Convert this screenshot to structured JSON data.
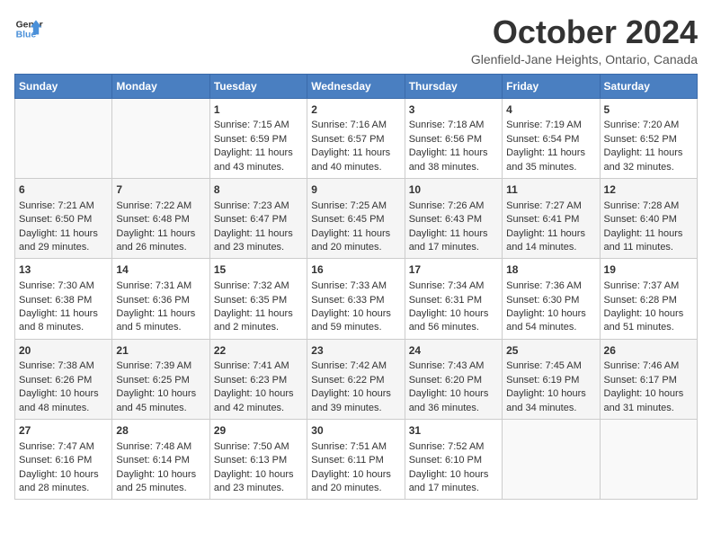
{
  "logo": {
    "line1": "General",
    "line2": "Blue"
  },
  "title": "October 2024",
  "subtitle": "Glenfield-Jane Heights, Ontario, Canada",
  "headers": [
    "Sunday",
    "Monday",
    "Tuesday",
    "Wednesday",
    "Thursday",
    "Friday",
    "Saturday"
  ],
  "weeks": [
    [
      {
        "day": "",
        "sunrise": "",
        "sunset": "",
        "daylight": ""
      },
      {
        "day": "",
        "sunrise": "",
        "sunset": "",
        "daylight": ""
      },
      {
        "day": "1",
        "sunrise": "Sunrise: 7:15 AM",
        "sunset": "Sunset: 6:59 PM",
        "daylight": "Daylight: 11 hours and 43 minutes."
      },
      {
        "day": "2",
        "sunrise": "Sunrise: 7:16 AM",
        "sunset": "Sunset: 6:57 PM",
        "daylight": "Daylight: 11 hours and 40 minutes."
      },
      {
        "day": "3",
        "sunrise": "Sunrise: 7:18 AM",
        "sunset": "Sunset: 6:56 PM",
        "daylight": "Daylight: 11 hours and 38 minutes."
      },
      {
        "day": "4",
        "sunrise": "Sunrise: 7:19 AM",
        "sunset": "Sunset: 6:54 PM",
        "daylight": "Daylight: 11 hours and 35 minutes."
      },
      {
        "day": "5",
        "sunrise": "Sunrise: 7:20 AM",
        "sunset": "Sunset: 6:52 PM",
        "daylight": "Daylight: 11 hours and 32 minutes."
      }
    ],
    [
      {
        "day": "6",
        "sunrise": "Sunrise: 7:21 AM",
        "sunset": "Sunset: 6:50 PM",
        "daylight": "Daylight: 11 hours and 29 minutes."
      },
      {
        "day": "7",
        "sunrise": "Sunrise: 7:22 AM",
        "sunset": "Sunset: 6:48 PM",
        "daylight": "Daylight: 11 hours and 26 minutes."
      },
      {
        "day": "8",
        "sunrise": "Sunrise: 7:23 AM",
        "sunset": "Sunset: 6:47 PM",
        "daylight": "Daylight: 11 hours and 23 minutes."
      },
      {
        "day": "9",
        "sunrise": "Sunrise: 7:25 AM",
        "sunset": "Sunset: 6:45 PM",
        "daylight": "Daylight: 11 hours and 20 minutes."
      },
      {
        "day": "10",
        "sunrise": "Sunrise: 7:26 AM",
        "sunset": "Sunset: 6:43 PM",
        "daylight": "Daylight: 11 hours and 17 minutes."
      },
      {
        "day": "11",
        "sunrise": "Sunrise: 7:27 AM",
        "sunset": "Sunset: 6:41 PM",
        "daylight": "Daylight: 11 hours and 14 minutes."
      },
      {
        "day": "12",
        "sunrise": "Sunrise: 7:28 AM",
        "sunset": "Sunset: 6:40 PM",
        "daylight": "Daylight: 11 hours and 11 minutes."
      }
    ],
    [
      {
        "day": "13",
        "sunrise": "Sunrise: 7:30 AM",
        "sunset": "Sunset: 6:38 PM",
        "daylight": "Daylight: 11 hours and 8 minutes."
      },
      {
        "day": "14",
        "sunrise": "Sunrise: 7:31 AM",
        "sunset": "Sunset: 6:36 PM",
        "daylight": "Daylight: 11 hours and 5 minutes."
      },
      {
        "day": "15",
        "sunrise": "Sunrise: 7:32 AM",
        "sunset": "Sunset: 6:35 PM",
        "daylight": "Daylight: 11 hours and 2 minutes."
      },
      {
        "day": "16",
        "sunrise": "Sunrise: 7:33 AM",
        "sunset": "Sunset: 6:33 PM",
        "daylight": "Daylight: 10 hours and 59 minutes."
      },
      {
        "day": "17",
        "sunrise": "Sunrise: 7:34 AM",
        "sunset": "Sunset: 6:31 PM",
        "daylight": "Daylight: 10 hours and 56 minutes."
      },
      {
        "day": "18",
        "sunrise": "Sunrise: 7:36 AM",
        "sunset": "Sunset: 6:30 PM",
        "daylight": "Daylight: 10 hours and 54 minutes."
      },
      {
        "day": "19",
        "sunrise": "Sunrise: 7:37 AM",
        "sunset": "Sunset: 6:28 PM",
        "daylight": "Daylight: 10 hours and 51 minutes."
      }
    ],
    [
      {
        "day": "20",
        "sunrise": "Sunrise: 7:38 AM",
        "sunset": "Sunset: 6:26 PM",
        "daylight": "Daylight: 10 hours and 48 minutes."
      },
      {
        "day": "21",
        "sunrise": "Sunrise: 7:39 AM",
        "sunset": "Sunset: 6:25 PM",
        "daylight": "Daylight: 10 hours and 45 minutes."
      },
      {
        "day": "22",
        "sunrise": "Sunrise: 7:41 AM",
        "sunset": "Sunset: 6:23 PM",
        "daylight": "Daylight: 10 hours and 42 minutes."
      },
      {
        "day": "23",
        "sunrise": "Sunrise: 7:42 AM",
        "sunset": "Sunset: 6:22 PM",
        "daylight": "Daylight: 10 hours and 39 minutes."
      },
      {
        "day": "24",
        "sunrise": "Sunrise: 7:43 AM",
        "sunset": "Sunset: 6:20 PM",
        "daylight": "Daylight: 10 hours and 36 minutes."
      },
      {
        "day": "25",
        "sunrise": "Sunrise: 7:45 AM",
        "sunset": "Sunset: 6:19 PM",
        "daylight": "Daylight: 10 hours and 34 minutes."
      },
      {
        "day": "26",
        "sunrise": "Sunrise: 7:46 AM",
        "sunset": "Sunset: 6:17 PM",
        "daylight": "Daylight: 10 hours and 31 minutes."
      }
    ],
    [
      {
        "day": "27",
        "sunrise": "Sunrise: 7:47 AM",
        "sunset": "Sunset: 6:16 PM",
        "daylight": "Daylight: 10 hours and 28 minutes."
      },
      {
        "day": "28",
        "sunrise": "Sunrise: 7:48 AM",
        "sunset": "Sunset: 6:14 PM",
        "daylight": "Daylight: 10 hours and 25 minutes."
      },
      {
        "day": "29",
        "sunrise": "Sunrise: 7:50 AM",
        "sunset": "Sunset: 6:13 PM",
        "daylight": "Daylight: 10 hours and 23 minutes."
      },
      {
        "day": "30",
        "sunrise": "Sunrise: 7:51 AM",
        "sunset": "Sunset: 6:11 PM",
        "daylight": "Daylight: 10 hours and 20 minutes."
      },
      {
        "day": "31",
        "sunrise": "Sunrise: 7:52 AM",
        "sunset": "Sunset: 6:10 PM",
        "daylight": "Daylight: 10 hours and 17 minutes."
      },
      {
        "day": "",
        "sunrise": "",
        "sunset": "",
        "daylight": ""
      },
      {
        "day": "",
        "sunrise": "",
        "sunset": "",
        "daylight": ""
      }
    ]
  ]
}
